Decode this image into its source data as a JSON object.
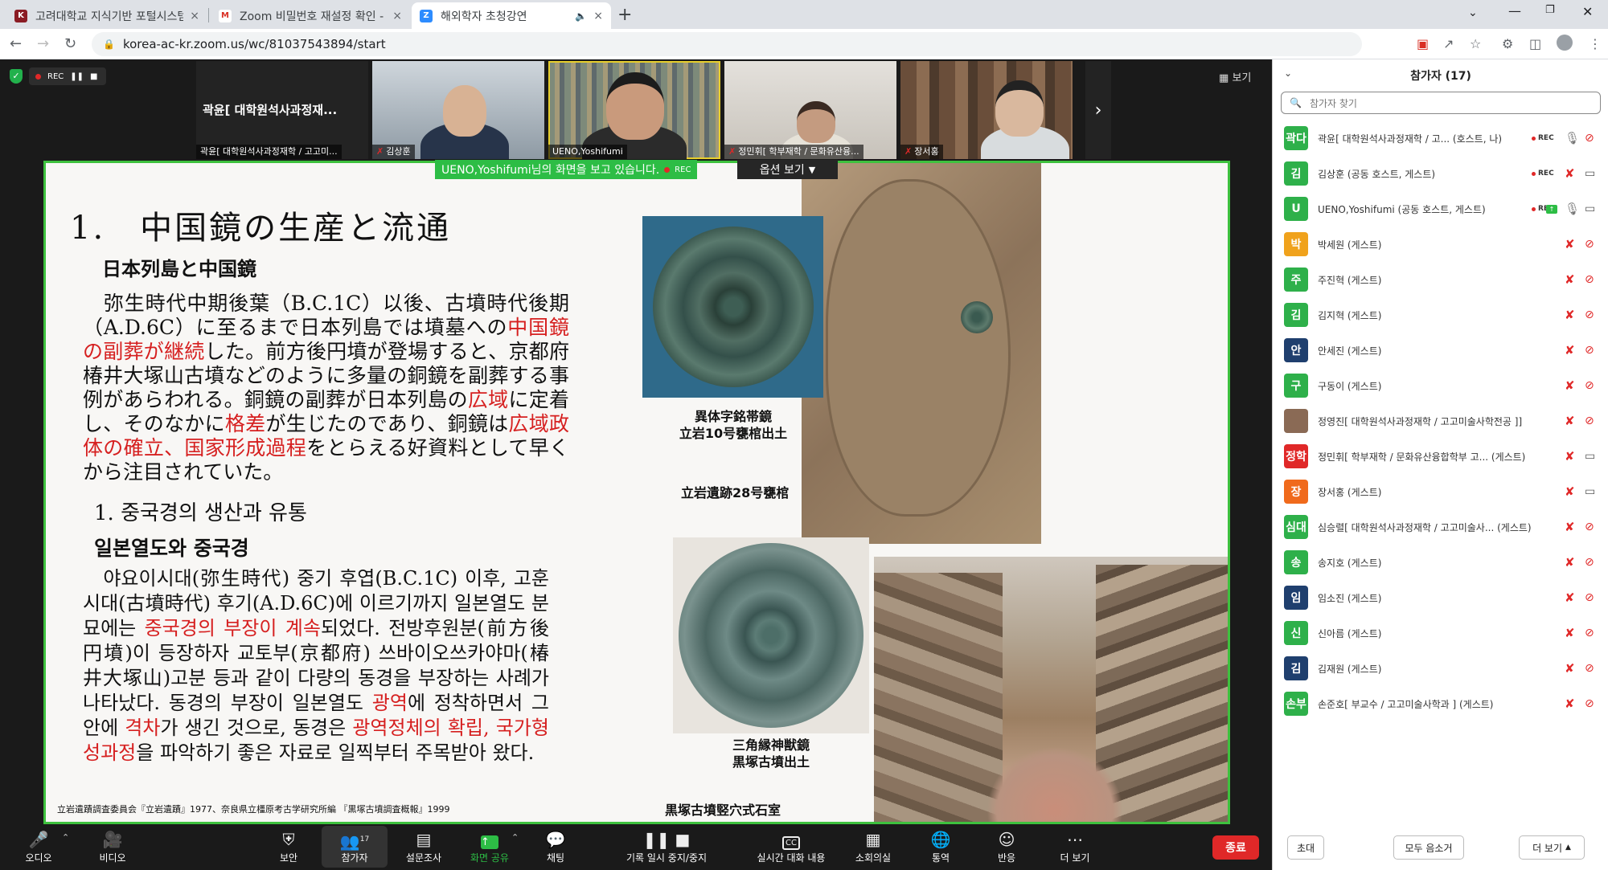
{
  "browser": {
    "tabs": [
      {
        "title": "고려대학교 지식기반 포털시스템",
        "close": "×",
        "fav": "K",
        "color": "#8b1c24"
      },
      {
        "title": "Zoom 비밀번호 재설정 확인 - g",
        "close": "×",
        "fav": "M",
        "color": "#d93025"
      },
      {
        "title": "해외학자 초청강연",
        "close": "×",
        "fav": "Z",
        "color": "#2d8cff"
      }
    ],
    "new_tab": "+",
    "url": "korea-ac-kr.zoom.us/wc/81037543894/start"
  },
  "meeting": {
    "rec_label": "REC",
    "view_label": "보기",
    "share_banner": "UENO,Yoshifumi님의 화면을 보고 있습니다.",
    "banner_rec": "REC",
    "options_label": "옵션 보기",
    "tiles": [
      {
        "big": "곽윤[ 대학원석사과정재...",
        "name": "곽윤[ 대학원석사과정재학 / 고고미..."
      },
      {
        "name": "김상훈"
      },
      {
        "name": "UENO,Yoshifumi"
      },
      {
        "name": "정민휘[ 학부재학 / 문화유산융..."
      },
      {
        "name": "장서홍"
      }
    ]
  },
  "slide": {
    "title": "1.　中国鏡の生産と流通",
    "jp_subtitle": "日本列島と中国鏡",
    "jp_body": [
      {
        "t": "　弥生時代中期後葉（B.C.1C）以後、古墳時代後期（A.D.6C）に至るまで日本列島では墳墓への",
        "red": false
      },
      {
        "t": "中国鏡の副葬が継続",
        "red": true
      },
      {
        "t": "した。前方後円墳が登場すると、京都府椿井大塚山古墳などのように多量の銅鏡を副葬する事例があらわれる。銅鏡の副葬が日本列島の",
        "red": false
      },
      {
        "t": "広域",
        "red": true
      },
      {
        "t": "に定着し、そのなかに",
        "red": false
      },
      {
        "t": "格差",
        "red": true
      },
      {
        "t": "が生じたのであり、銅鏡は",
        "red": false
      },
      {
        "t": "広域政体の確立、国家形成過程",
        "red": true
      },
      {
        "t": "をとらえる好資料として早くから注目されていた。",
        "red": false
      }
    ],
    "kr_title": "1.  중국경의 생산과 유통",
    "kr_subtitle": "일본열도와 중국경",
    "kr_body": [
      {
        "t": "　야요이시대(弥生時代) 중기 후엽(B.C.1C) 이후, 고훈시대(古墳時代) 후기(A.D.6C)에 이르기까지 일본열도 분묘에는 ",
        "red": false
      },
      {
        "t": "중국경의 부장이 계속",
        "red": true
      },
      {
        "t": "되었다. 전방후원분(前方後円墳)이 등장하자 교토부(京都府) 쓰바이오쓰카야마(椿井大塚山)고분 등과 같이 다량의 동경을 부장하는 사례가 나타났다. 동경의 부장이 일본열도 ",
        "red": false
      },
      {
        "t": "광역",
        "red": true
      },
      {
        "t": "에 정착하면서 그 안에 ",
        "red": false
      },
      {
        "t": "격차",
        "red": true
      },
      {
        "t": "가 생긴 것으로, 동경은 ",
        "red": false
      },
      {
        "t": "광역정체의 확립, 국가형성과정",
        "red": true
      },
      {
        "t": "을 파악하기 좋은 자료로 일찍부터 주목받아 왔다.",
        "red": false
      }
    ],
    "cap1_l1": "異体字銘帯鏡",
    "cap1_l2": "立岩10号甕棺出土",
    "cap_site": "立岩遺跡28号甕棺",
    "cap2_l1": "三角縁神獣鏡",
    "cap2_l2": "黒塚古墳出土",
    "cap_chamber": "黒塚古墳竪穴式石室",
    "credit": "立岩遺蹟調査委員会『立岩遺蹟』1977、奈良県立橿原考古学研究所編 『黒塚古墳調査概報』1999"
  },
  "toolbar": {
    "audio": "오디오",
    "video": "비디오",
    "security": "보안",
    "participants": "참가자",
    "participants_count": "17",
    "polls": "설문조사",
    "share_screen": "화면 공유",
    "chat": "채팅",
    "record": "기록 일시 중지/중지",
    "cc_label": "CC",
    "captions": "실시간 대화 내용",
    "breakout": "소회의실",
    "interpret": "통역",
    "reactions": "반응",
    "more": "더 보기",
    "end": "종료"
  },
  "panel": {
    "title": "참가자 (17)",
    "search_placeholder": "참가자 찾기",
    "participants": [
      {
        "avatar": "곽다",
        "color": "#2eb04a",
        "name": "곽윤[ 대학원석사과정재학 / 고... (호스트, 나)",
        "rec": "REC",
        "mic": "on",
        "cam": "off"
      },
      {
        "avatar": "김",
        "color": "#2eb04a",
        "name": "김상훈 (공동 호스트, 게스트)",
        "rec": "REC",
        "mic": "off",
        "cam": "on"
      },
      {
        "avatar": "U",
        "color": "#2eb04a",
        "name": "UENO,Yoshifumi (공동 호스트, 게스트)",
        "rec": "REC",
        "mic": "on",
        "cam": "on",
        "share": true
      },
      {
        "avatar": "박",
        "color": "#f0a21c",
        "name": "박세원 (게스트)",
        "mic": "off",
        "cam": "off"
      },
      {
        "avatar": "주",
        "color": "#2eb04a",
        "name": "주진혁 (게스트)",
        "mic": "off",
        "cam": "off"
      },
      {
        "avatar": "김",
        "color": "#2eb04a",
        "name": "김지혁 (게스트)",
        "mic": "off",
        "cam": "off"
      },
      {
        "avatar": "안",
        "color": "#1f3f6e",
        "name": "안세진 (게스트)",
        "mic": "off",
        "cam": "off"
      },
      {
        "avatar": "구",
        "color": "#2eb04a",
        "name": "구동이 (게스트)",
        "mic": "off",
        "cam": "off"
      },
      {
        "avatar": "",
        "color": "#8a6a55",
        "name": "정영진[ 대학원석사과정재학 / 고고미술사학전공 ]]",
        "mic": "off",
        "cam": "off"
      },
      {
        "avatar": "정학",
        "color": "#e02828",
        "name": "정민휘[ 학부재학 / 문화유산융합학부 고... (게스트)",
        "mic": "off",
        "cam": "on"
      },
      {
        "avatar": "장",
        "color": "#f06a1c",
        "name": "장서홍 (게스트)",
        "mic": "off",
        "cam": "on"
      },
      {
        "avatar": "심대",
        "color": "#2eb04a",
        "name": "심승렬[ 대학원석사과정재학 / 고고미술사... (게스트)",
        "mic": "off",
        "cam": "off"
      },
      {
        "avatar": "송",
        "color": "#2eb04a",
        "name": "송지호 (게스트)",
        "mic": "off",
        "cam": "off"
      },
      {
        "avatar": "임",
        "color": "#1f3f6e",
        "name": "임소진 (게스트)",
        "mic": "off",
        "cam": "off"
      },
      {
        "avatar": "신",
        "color": "#2eb04a",
        "name": "신아름 (게스트)",
        "mic": "off",
        "cam": "off"
      },
      {
        "avatar": "김",
        "color": "#1f3f6e",
        "name": "김재원 (게스트)",
        "mic": "off",
        "cam": "off"
      },
      {
        "avatar": "손부",
        "color": "#2eb04a",
        "name": "손준호[ 부교수 / 고고미술사학과 ] (게스트)",
        "mic": "off",
        "cam": "off"
      }
    ],
    "invite": "초대",
    "mute_all": "모두 음소거",
    "more": "더 보기"
  }
}
